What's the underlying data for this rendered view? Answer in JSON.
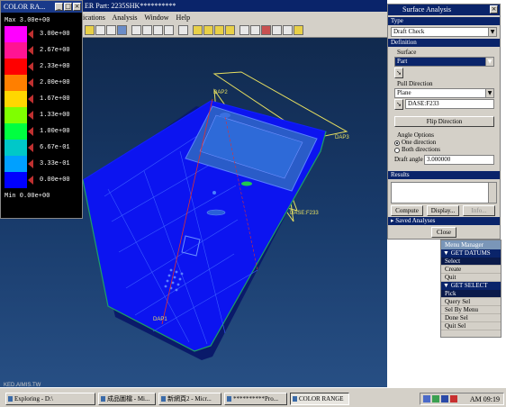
{
  "app": {
    "title": "ER Part: 2235SHK**********",
    "menu": [
      "ications",
      "Analysis",
      "Window",
      "Help"
    ]
  },
  "color_range": {
    "title": "COLOR RA...",
    "max_label": "Max  3.00e+00",
    "min_label": "Min  0.00e+00",
    "bands": [
      {
        "value": "3.00e+00",
        "color": "#ff00ff"
      },
      {
        "value": "2.67e+00",
        "color": "#ff1493"
      },
      {
        "value": "2.33e+00",
        "color": "#ff0000"
      },
      {
        "value": "2.00e+00",
        "color": "#ff7f00"
      },
      {
        "value": "1.67e+00",
        "color": "#ffd700"
      },
      {
        "value": "1.33e+00",
        "color": "#7fff00"
      },
      {
        "value": "1.00e+00",
        "color": "#00ff40"
      },
      {
        "value": "6.67e-01",
        "color": "#00c8c8"
      },
      {
        "value": "3.33e-01",
        "color": "#00a0ff"
      },
      {
        "value": "0.00e+00",
        "color": "#0000ff"
      }
    ]
  },
  "surface_analysis": {
    "title": "Surface Analysis",
    "type_header": "Type",
    "type_value": "Draft Check",
    "definition_header": "Definition",
    "surface_label": "Surface",
    "surface_value": "Part",
    "pull_direction_label": "Pull Direction",
    "pull_direction_value": "Plane",
    "datum_value": "DASE:F233",
    "flip_button": "Flip Direction",
    "angle_options_label": "Angle Options",
    "one_direction": "One direction",
    "both_directions": "Both directions",
    "draft_angle_label": "Draft angle",
    "draft_angle_value": "3.000000",
    "results_header": "Results",
    "compute_button": "Compute",
    "display_button": "Display...",
    "info_button": "Info...",
    "saved_analyses": "Saved Analyses",
    "close_button": "Close"
  },
  "model_labels": {
    "datum_top": "DAP2",
    "datum_right": "DAP3",
    "datum_mid": "DASE:F233",
    "datum_bottom": "DAP1"
  },
  "menu_manager": {
    "title": "Menu Manager",
    "group1": "GET DATUMS",
    "group1_items": [
      "Select",
      "Create",
      "Quit"
    ],
    "group2": "GET SELECT",
    "group2_items": [
      "Pick",
      "Query Sel",
      "Sel By Menu",
      "Done Sel",
      "Quit Sel"
    ]
  },
  "taskbar": {
    "tasks": [
      "Exploring - D:\\",
      "成品圖檔 - Mi...",
      "新網頁2 - Micr...",
      "**********Pro...",
      "COLOR RANGE"
    ],
    "clock": "AM 09:19"
  },
  "watermark": "KED.AIMIS.TW"
}
